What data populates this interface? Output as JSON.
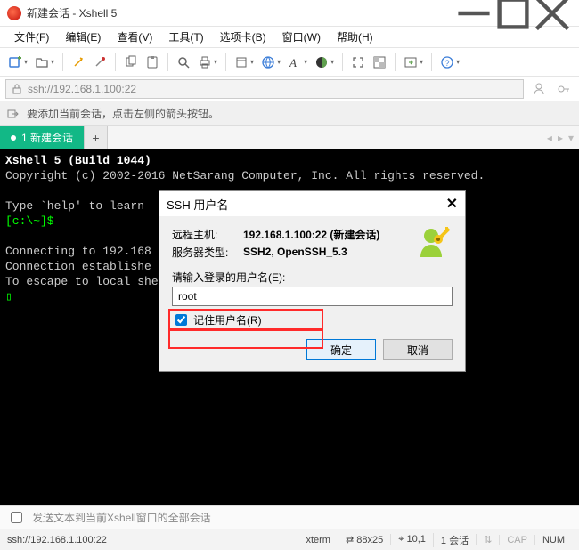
{
  "window": {
    "title": "新建会话 - Xshell 5"
  },
  "menu": {
    "file": "文件(F)",
    "edit": "编辑(E)",
    "view": "查看(V)",
    "tools": "工具(T)",
    "tabs": "选项卡(B)",
    "window": "窗口(W)",
    "help": "帮助(H)"
  },
  "address": {
    "value": "ssh://192.168.1.100:22"
  },
  "infobar": {
    "text": "要添加当前会话，点击左侧的箭头按钮。"
  },
  "tabs": {
    "active": "1 新建会话",
    "add": "+"
  },
  "terminal": {
    "line1": "Xshell 5 (Build 1044)",
    "line2": "Copyright (c) 2002-2016 NetSarang Computer, Inc. All rights reserved.",
    "line3": "Type `help' to learn ",
    "prompt": "[c:\\~]$",
    "line4": "Connecting to 192.168",
    "line5": "Connection establishe",
    "line6": "To escape to local she",
    "cursor": "▯"
  },
  "dialog": {
    "title": "SSH 用户名",
    "remote_host_label": "远程主机:",
    "remote_host_value": "192.168.1.100:22 (新建会话)",
    "server_type_label": "服务器类型:",
    "server_type_value": "SSH2, OpenSSH_5.3",
    "prompt": "请输入登录的用户名(E):",
    "username_value": "root",
    "remember_label": "记住用户名(R)",
    "ok": "确定",
    "cancel": "取消"
  },
  "sendbar": {
    "text": "发送文本到当前Xshell窗口的全部会话"
  },
  "status": {
    "conn": "ssh://192.168.1.100:22",
    "term": "xterm",
    "size": "88x25",
    "pos": "10,1",
    "sessions": "1 会话",
    "caps": "CAP",
    "num": "NUM"
  }
}
